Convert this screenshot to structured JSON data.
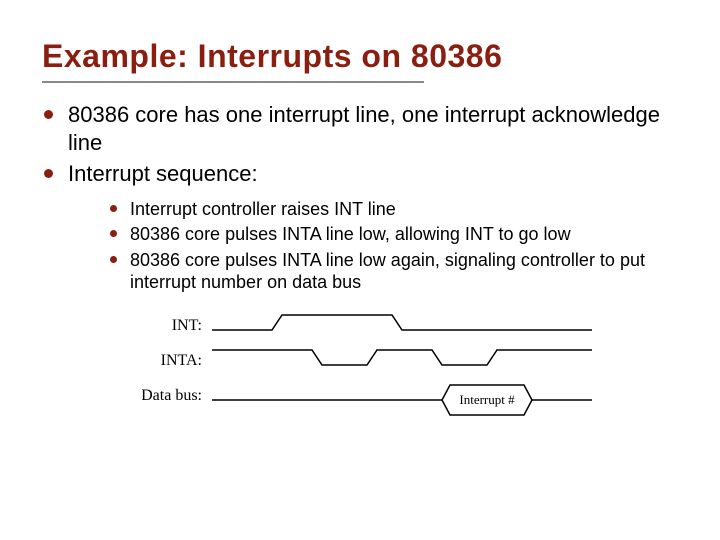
{
  "title": "Example: Interrupts on 80386",
  "bullets": {
    "b1": "80386 core has one interrupt line, one interrupt acknowledge line",
    "b2": "Interrupt sequence:"
  },
  "sub": {
    "s1": "Interrupt controller raises INT line",
    "s2": "80386 core pulses INTA line low, allowing INT to go low",
    "s3": "80386 core pulses INTA line low again, signaling controller to put interrupt number on data bus"
  },
  "diagram": {
    "labels": {
      "int": "INT:",
      "inta": "INTA:",
      "databus": "Data bus:"
    },
    "annotation": "Interrupt #"
  }
}
